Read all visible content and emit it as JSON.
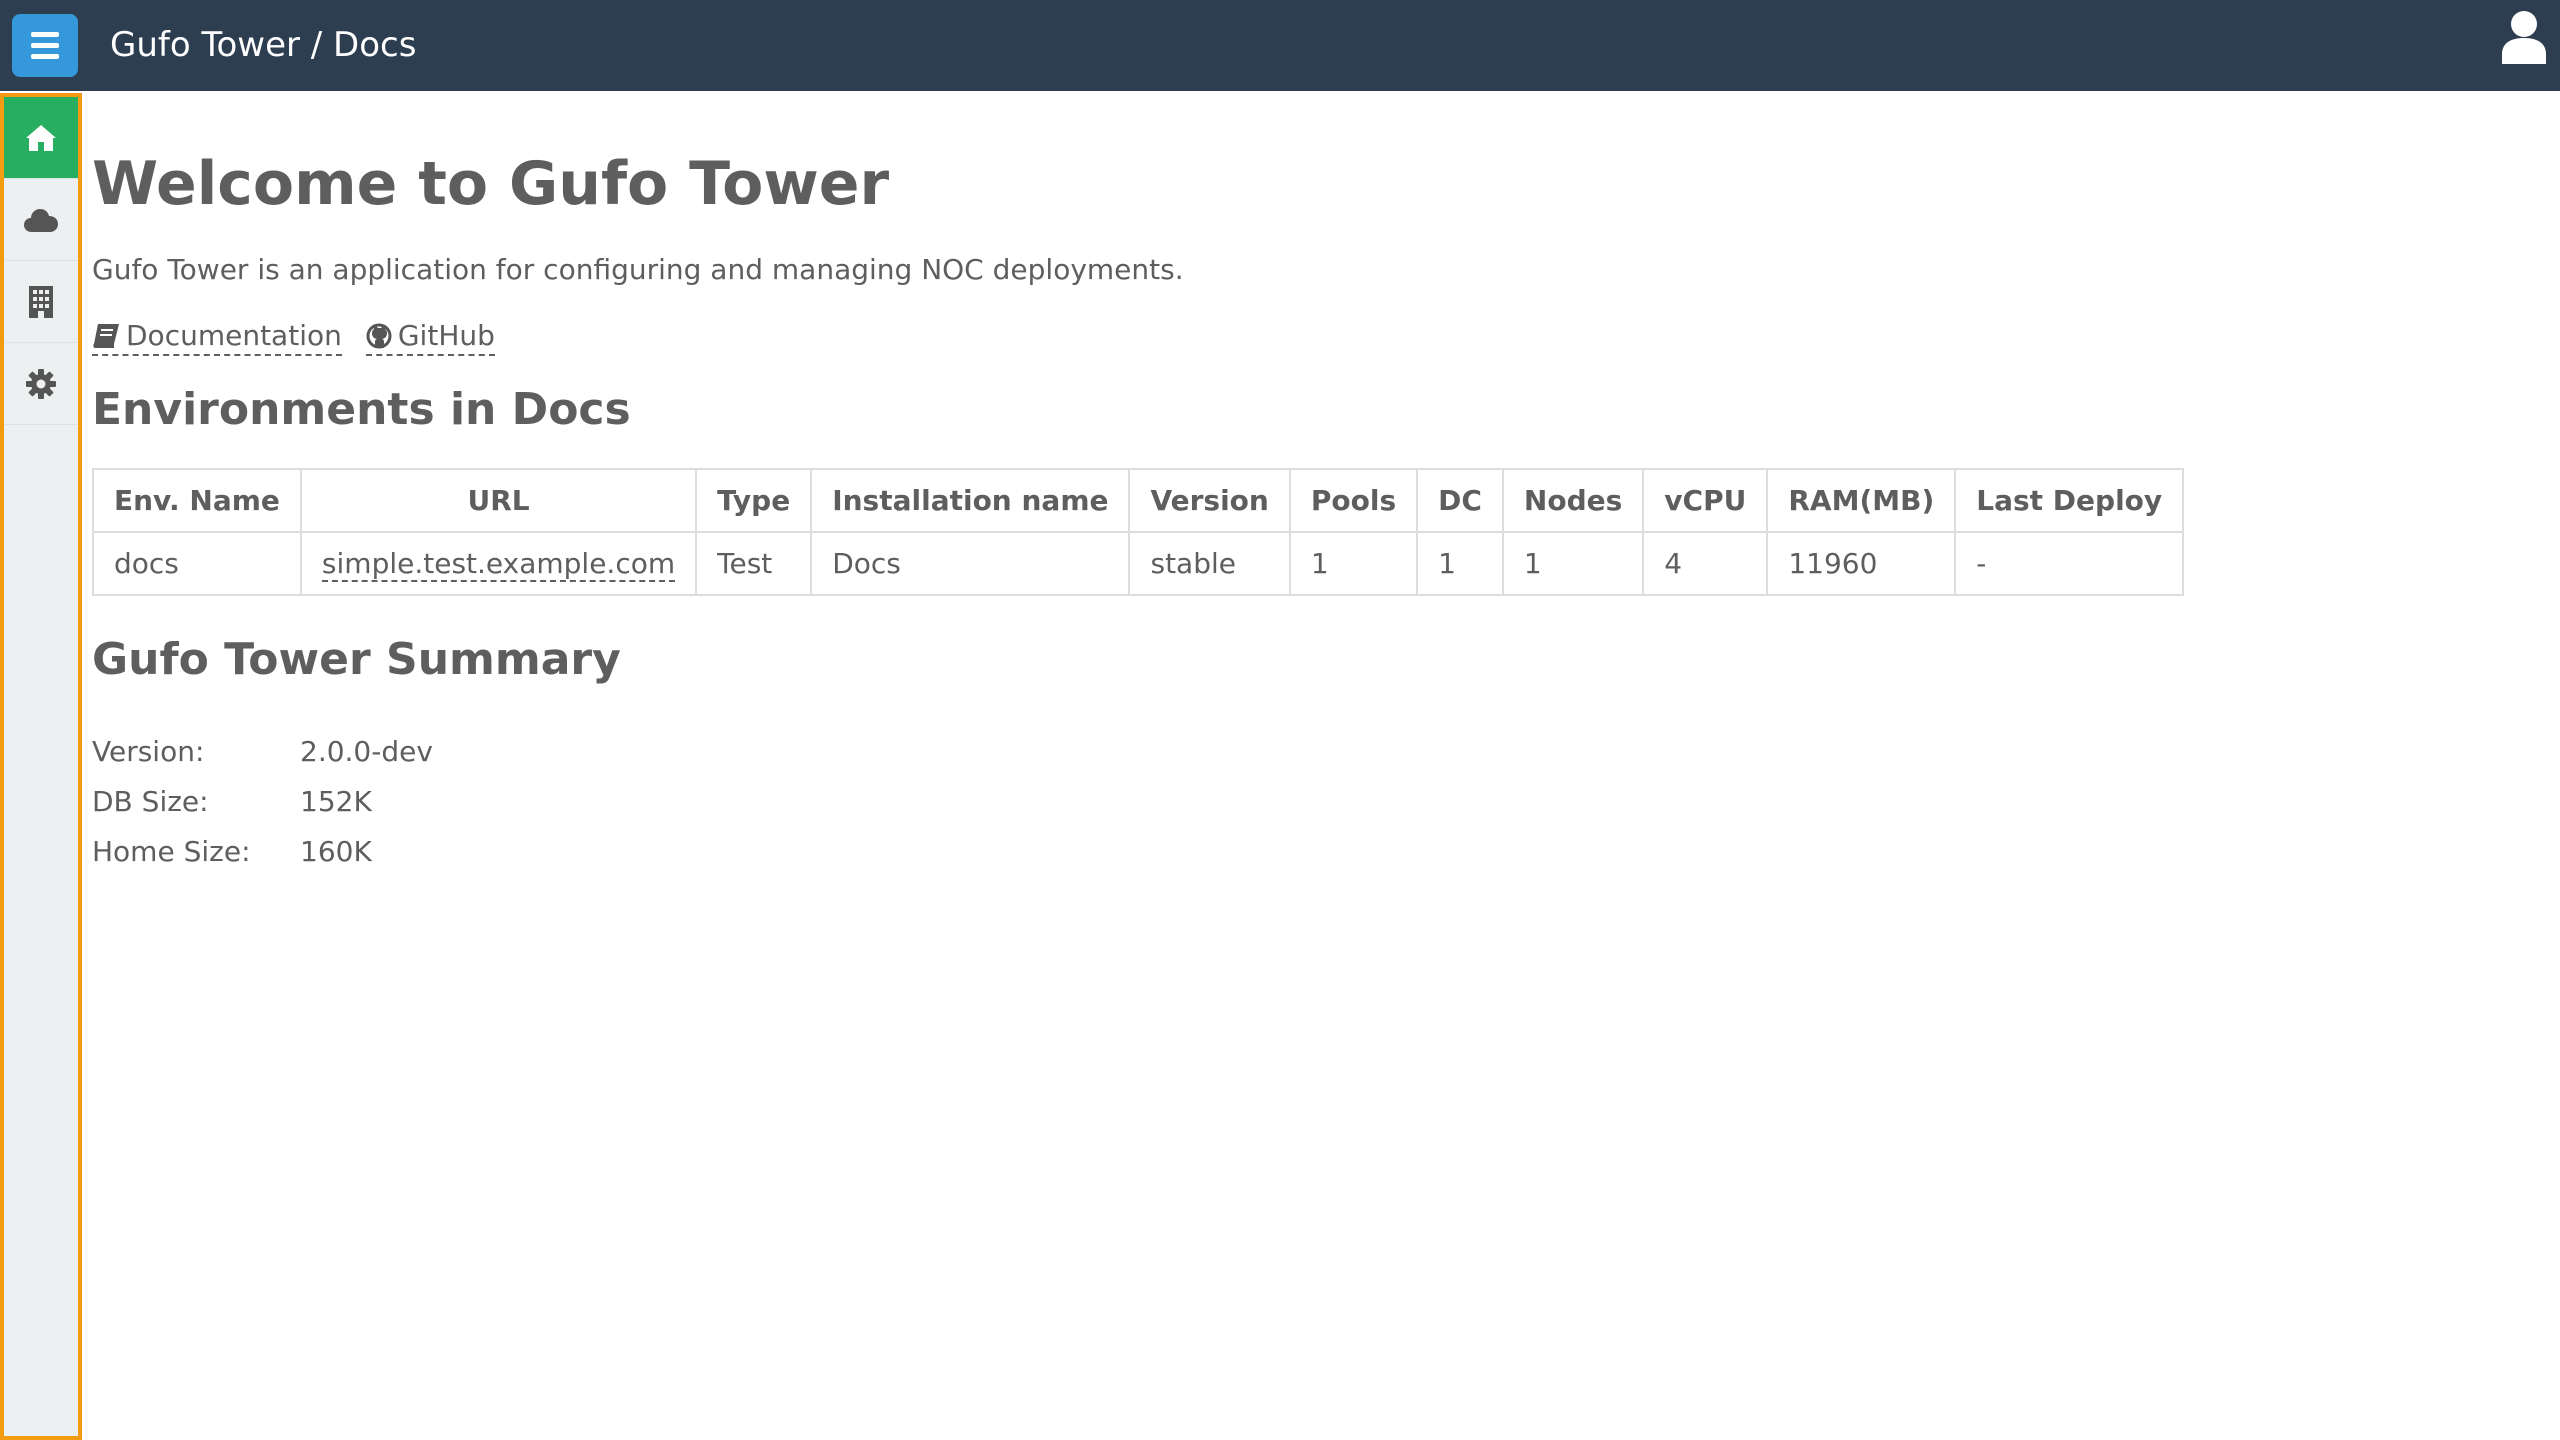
{
  "header": {
    "title": "Gufo Tower / Docs",
    "menu_icon": "hamburger-menu-icon",
    "user_icon": "user-icon",
    "bg_color": "#2c3e50",
    "menu_color": "#3498db"
  },
  "sidebar": {
    "highlight_color": "#f39c12",
    "active_color": "#27ae60",
    "items": [
      {
        "icon": "home-icon",
        "active": true
      },
      {
        "icon": "cloud-icon",
        "active": false
      },
      {
        "icon": "building-icon",
        "active": false
      },
      {
        "icon": "gear-icon",
        "active": false
      }
    ]
  },
  "main": {
    "title": "Welcome to Gufo Tower",
    "intro": "Gufo Tower is an application for configuring and managing NOC deployments.",
    "links": {
      "documentation": {
        "label": "Documentation",
        "icon": "book-icon"
      },
      "github": {
        "label": "GitHub",
        "icon": "github-icon"
      }
    },
    "environments": {
      "title": "Environments in Docs",
      "columns": [
        "Env. Name",
        "URL",
        "Type",
        "Installation name",
        "Version",
        "Pools",
        "DC",
        "Nodes",
        "vCPU",
        "RAM(MB)",
        "Last Deploy"
      ],
      "rows": [
        [
          "docs",
          "simple.test.example.com",
          "Test",
          "Docs",
          "stable",
          "1",
          "1",
          "1",
          "4",
          "11960",
          "-"
        ]
      ]
    },
    "summary": {
      "title": "Gufo Tower Summary",
      "version_label": "Version:",
      "version_value": "2.0.0-dev",
      "db_size_label": "DB Size:",
      "db_size_value": "152K",
      "home_size_label": "Home Size:",
      "home_size_value": "160K"
    }
  }
}
